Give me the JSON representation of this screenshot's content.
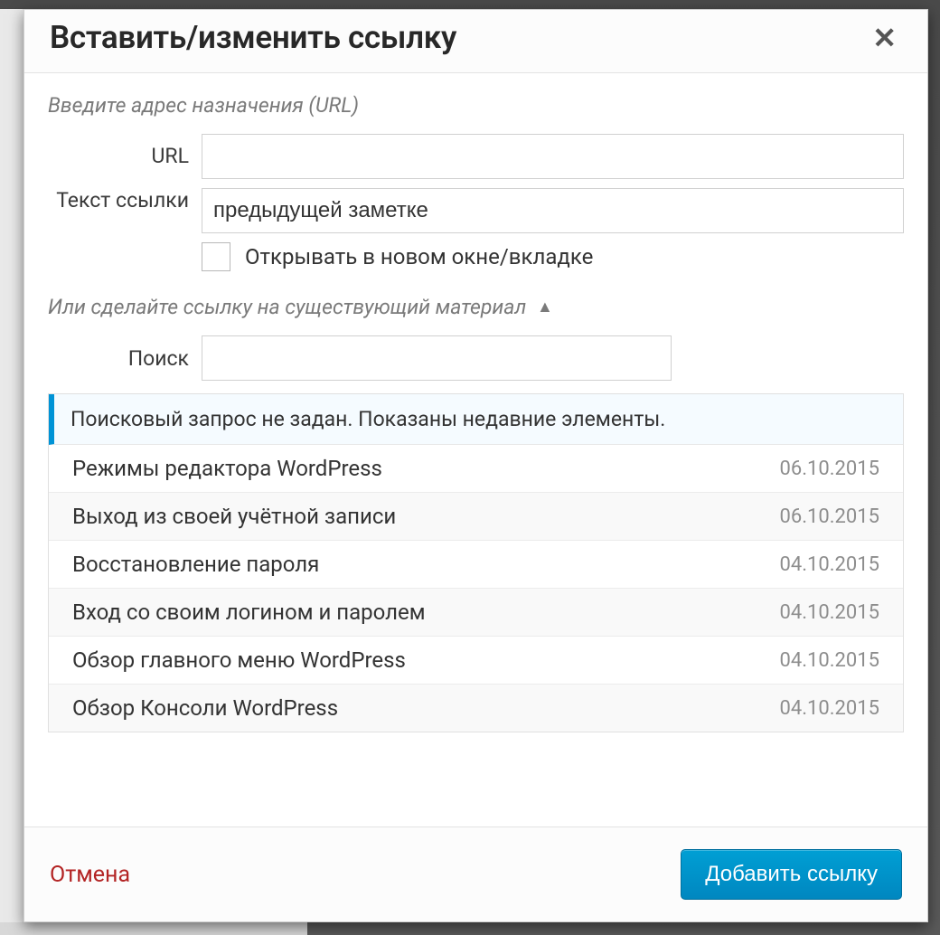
{
  "modal": {
    "title": "Вставить/изменить ссылку",
    "section_url_hint": "Введите адрес назначения (URL)",
    "url_label": "URL",
    "url_value": "",
    "text_label": "Текст ссылки",
    "text_value": "предыдущей заметке",
    "newtab_label": "Открывать в новом окне/вкладке",
    "section_existing_hint": "Или сделайте ссылку на существующий материал",
    "search_label": "Поиск",
    "search_value": "",
    "results_banner": "Поисковый запрос не задан. Показаны недавние элементы.",
    "results": [
      {
        "title": "Режимы редактора WordPress",
        "date": "06.10.2015"
      },
      {
        "title": "Выход из своей учётной записи",
        "date": "06.10.2015"
      },
      {
        "title": "Восстановление пароля",
        "date": "04.10.2015"
      },
      {
        "title": "Вход со своим логином и паролем",
        "date": "04.10.2015"
      },
      {
        "title": "Обзор главного меню WordPress",
        "date": "04.10.2015"
      },
      {
        "title": "Обзор Консоли WordPress",
        "date": "04.10.2015"
      }
    ],
    "cancel_label": "Отмена",
    "submit_label": "Добавить ссылку"
  }
}
